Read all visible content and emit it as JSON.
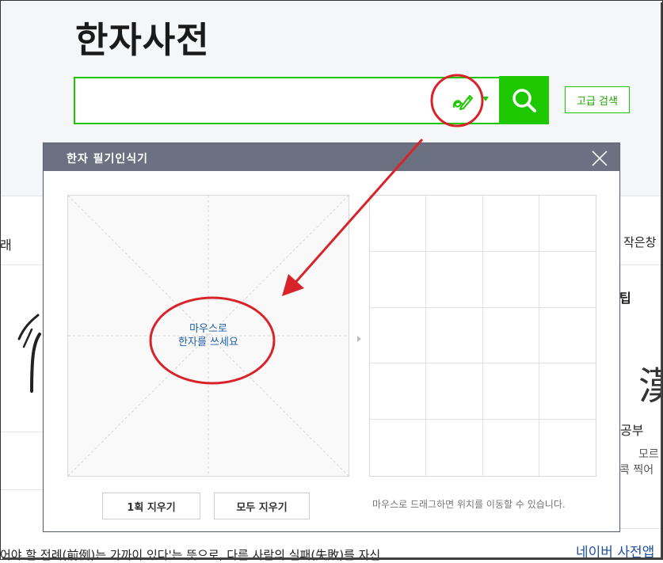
{
  "page": {
    "title": "한자사전"
  },
  "search": {
    "placeholder": "",
    "value": "",
    "handwriting_icon": "handwriting-pen-icon",
    "search_icon": "search-icon",
    "advanced_label": "고급 검색"
  },
  "background": {
    "left_tab_fragment": "래",
    "right_tab_fragment": "작은창",
    "side_heading_fragment": "팁",
    "study_fragment": "공부",
    "right_text_1": "모르",
    "right_text_2": "콕 찍어",
    "kanji_fragment": "漢",
    "bottom_link": "네이버 사전앱",
    "bottom_text": "어야 할 전례(前例)는 가까이 있다'는 뜻으로, 다른 사람의 실패(失敗)를 자신"
  },
  "modal": {
    "title": "한자 필기인식기",
    "close_icon": "close-icon",
    "pad_hint_line1": "마우스로",
    "pad_hint_line2": "한자를 쓰세요",
    "undo_label": "1획 지우기",
    "clear_label": "모두 지우기",
    "drag_hint": "마우스로 드래그하면 위치를 이동할 수 있습니다."
  },
  "colors": {
    "brand_green": "#1ec800",
    "modal_header": "#6b7180",
    "annotation_red": "#d9232a",
    "hint_blue": "#1f5fa6"
  }
}
